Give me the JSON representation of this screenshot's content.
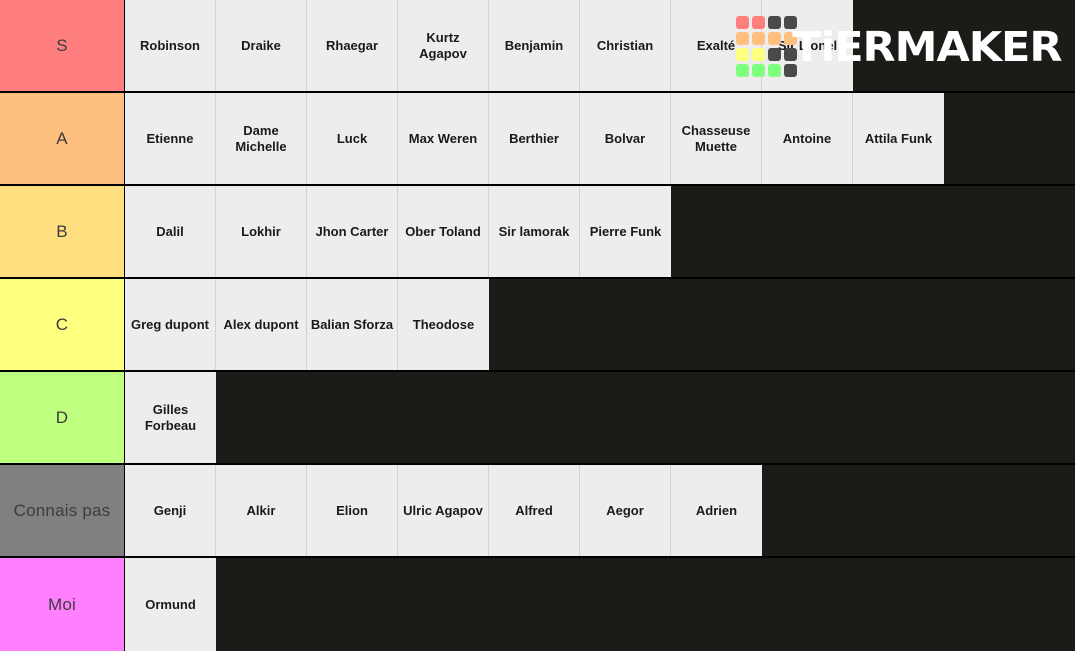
{
  "app": {
    "watermark_text": "TiERMAKER",
    "watermark_swatch_colors": [
      "#ff7f7f",
      "#ff7f7f",
      "#4a4a4a",
      "#4a4a4a",
      "#ffbf7f",
      "#ffbf7f",
      "#ffbf7f",
      "#ffbf7f",
      "#ffff7f",
      "#ffff7f",
      "#4a4a4a",
      "#4a4a4a",
      "#7fff7f",
      "#7fff7f",
      "#7fff7f",
      "#4a4a4a"
    ],
    "background_color": "#1b1b18",
    "item_background_color": "#ededed"
  },
  "tiers": [
    {
      "label": "S",
      "color": "#ff7f7f",
      "items": [
        "Robinson",
        "Draike",
        "Rhaegar",
        "Kurtz Agapov",
        "Benjamin",
        "Christian",
        "Exalté",
        "Sir Lionel"
      ]
    },
    {
      "label": "A",
      "color": "#ffbf7f",
      "items": [
        "Etienne",
        "Dame Michelle",
        "Luck",
        "Max Weren",
        "Berthier",
        "Bolvar",
        "Chasseuse Muette",
        "Antoine",
        "Attila Funk"
      ]
    },
    {
      "label": "B",
      "color": "#ffdf7f",
      "items": [
        "Dalil",
        "Lokhir",
        "Jhon Carter",
        "Ober Toland",
        "Sir lamorak",
        "Pierre Funk"
      ]
    },
    {
      "label": "C",
      "color": "#ffff7f",
      "items": [
        "Greg dupont",
        "Alex dupont",
        "Balian Sforza",
        "Theodose"
      ]
    },
    {
      "label": "D",
      "color": "#bfff7f",
      "items": [
        "Gilles Forbeau"
      ]
    },
    {
      "label": "Connais pas",
      "color": "#808080",
      "items": [
        "Genji",
        "Alkir",
        "Elion",
        "Ulric Agapov",
        "Alfred",
        "Aegor",
        "Adrien"
      ]
    },
    {
      "label": "Moi",
      "color": "#ff7fff",
      "items": [
        "Ormund"
      ]
    }
  ]
}
